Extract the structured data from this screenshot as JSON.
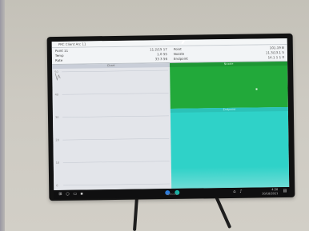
{
  "window": {
    "title": "PRC Client Arc 11"
  },
  "info": {
    "left": [
      {
        "label": "Point 11",
        "value": "11.2/15 17"
      },
      {
        "label": "Temp",
        "value": "1.0 55"
      },
      {
        "label": "Rate",
        "value": "33 3 56"
      }
    ],
    "right": [
      {
        "label": "Point",
        "value": "101.19 B"
      },
      {
        "label": "Nozzle",
        "value": "11.3/13.1 5"
      },
      {
        "label": "Endpoint",
        "value": "14.1 1 1 0"
      }
    ]
  },
  "panes": {
    "chart_header": "Chart",
    "green_header": "Nozzle",
    "cyan_header": "Endpoint"
  },
  "chart": {
    "y_ticks": [
      "50",
      "40",
      "30",
      "20",
      "10",
      "0"
    ]
  },
  "taskbar": {
    "time": "4:58",
    "date": "10/18/2021"
  },
  "monitor": {
    "brand": "lenovo"
  },
  "colors": {
    "green_pane": "#22a93a",
    "cyan_pane": "#2fd2c8",
    "chart_bg": "#e3e5ea"
  },
  "icons": [
    "windows-icon",
    "search-icon",
    "task-view-icon",
    "folder-icon",
    "chrome-icon",
    "network-icon",
    "volume-icon",
    "notification-icon"
  ]
}
